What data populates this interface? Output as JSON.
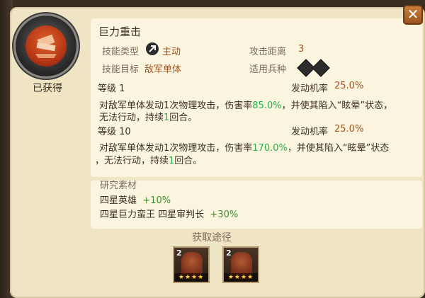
{
  "dialog": {
    "close_label": "✕",
    "obtained_label": "已获得"
  },
  "skill": {
    "name": "巨力重击",
    "type_label": "技能类型",
    "type_value": "主动",
    "range_label": "攻击距离",
    "range_value": "3",
    "target_label": "技能目标",
    "target_value": "敌军单体",
    "troop_label": "适用兵种",
    "levels": [
      {
        "level_label": "等级 1",
        "chance_label": "发动机率",
        "chance_value": "25.0%",
        "desc_prefix": "对敌军单体发动1次物理攻击，伤害率",
        "damage_rate": "85.0%",
        "desc_mid": "，并使其陷入“眩晕”状态，",
        "desc_line2_prefix": "无法行动，持续",
        "duration": "1",
        "desc_line2_suffix": "回合。"
      },
      {
        "level_label": "等级 10",
        "chance_label": "发动机率",
        "chance_value": "25.0%",
        "desc_prefix": "对敌军单体发动1次物理攻击，伤害率",
        "damage_rate": "170.0%",
        "desc_mid": "，并使其陷入“眩晕”状态",
        "desc_line2_prefix": "，无法行动，持续",
        "duration": "1",
        "desc_line2_suffix": "回合。"
      }
    ]
  },
  "research": {
    "title": "研究素材",
    "items": [
      {
        "name": "四星英雄",
        "bonus": "+10%"
      },
      {
        "name": "四星巨力蛮王 四星审判长",
        "bonus": "+30%"
      }
    ]
  },
  "acquire": {
    "title": "获取途径",
    "heroes": [
      {
        "count": "2",
        "stars": "★★★★"
      },
      {
        "count": "2",
        "stars": "★★★★"
      }
    ]
  },
  "colors": {
    "panel": "#efe4c4",
    "box": "#fbf5df",
    "brown_value": "#a0521f",
    "green_value": "#24b04a"
  }
}
